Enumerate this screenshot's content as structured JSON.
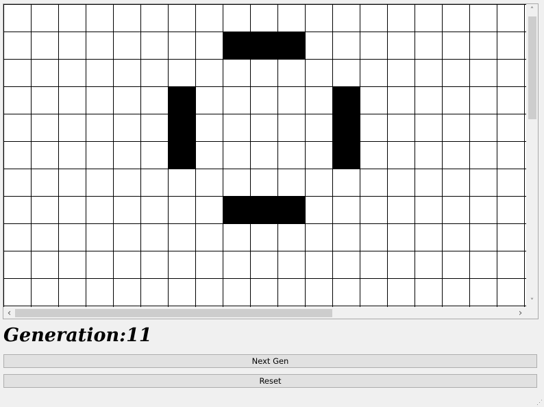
{
  "grid": {
    "rows": 12,
    "cols": 20,
    "alive_cells": [
      [
        1,
        8
      ],
      [
        1,
        9
      ],
      [
        1,
        10
      ],
      [
        3,
        6
      ],
      [
        4,
        6
      ],
      [
        5,
        6
      ],
      [
        3,
        12
      ],
      [
        4,
        12
      ],
      [
        5,
        12
      ],
      [
        7,
        8
      ],
      [
        7,
        9
      ],
      [
        7,
        10
      ]
    ],
    "alive_color": "#000000",
    "dead_color": "#ffffff",
    "line_color": "#000000"
  },
  "scrollbars": {
    "up_arrow": "˄",
    "down_arrow": "˅",
    "left_arrow": "‹",
    "right_arrow": "›"
  },
  "generation": {
    "label": "Generation:",
    "value": "11"
  },
  "buttons": {
    "next_label": "Next Gen",
    "reset_label": "Reset"
  },
  "icons": {
    "size_grip": "size-grip-icon"
  }
}
